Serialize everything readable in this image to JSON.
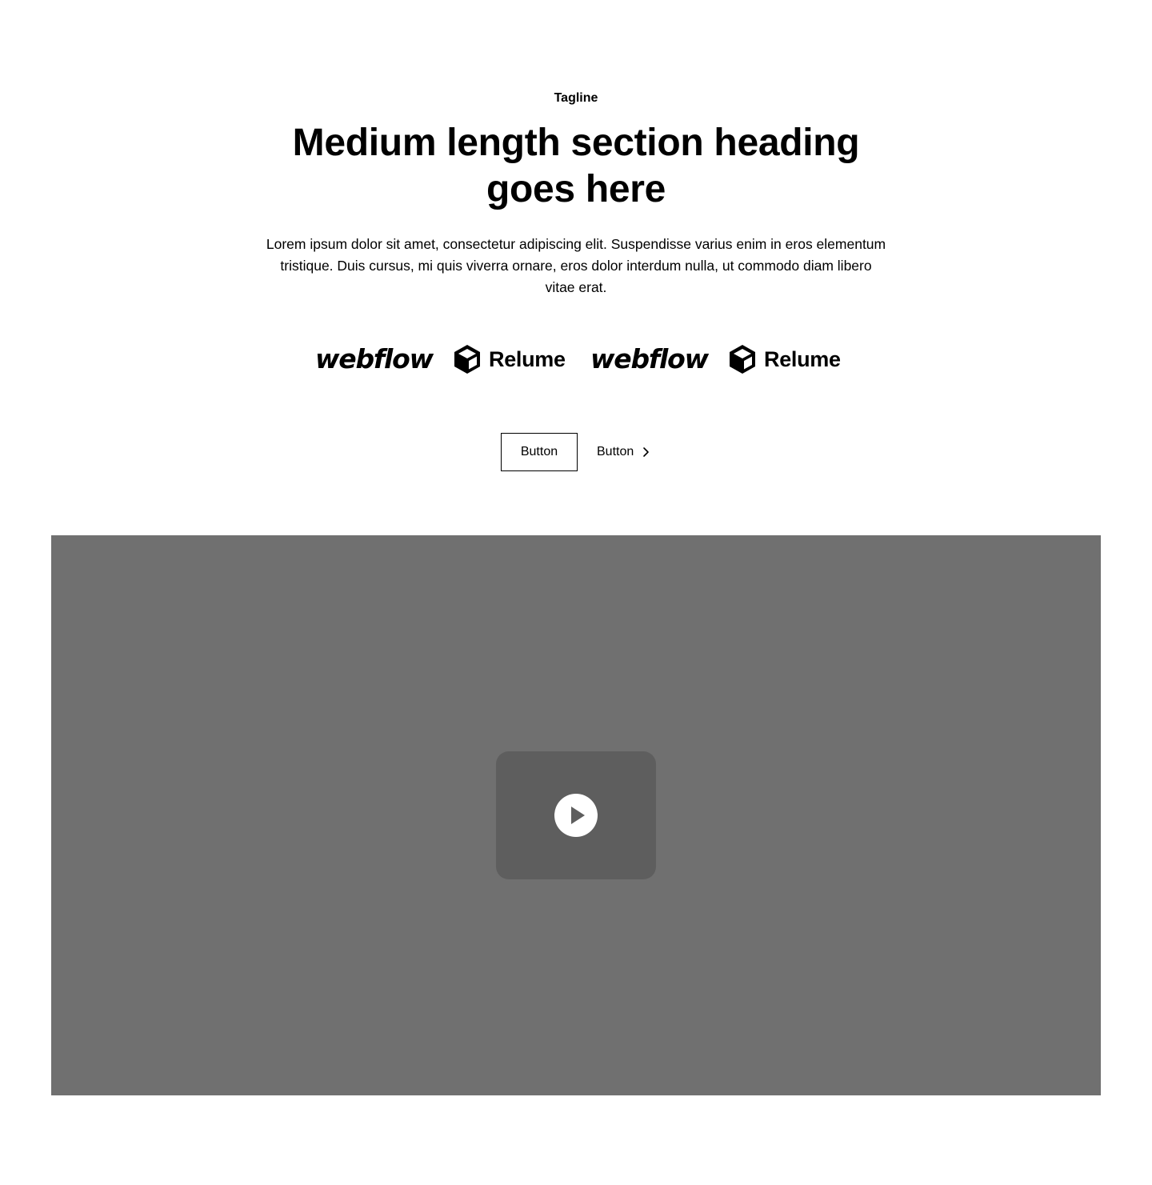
{
  "header": {
    "tagline": "Tagline",
    "heading": "Medium length section heading goes here",
    "body": "Lorem ipsum dolor sit amet, consectetur adipiscing elit. Suspendisse varius enim in eros elementum tristique. Duis cursus, mi quis viverra ornare, eros dolor interdum nulla, ut commodo diam libero vitae erat."
  },
  "logos": [
    {
      "name": "webflow",
      "icon": "webflow-logo"
    },
    {
      "name": "Relume",
      "icon": "relume-cube-logo"
    },
    {
      "name": "webflow",
      "icon": "webflow-logo"
    },
    {
      "name": "Relume",
      "icon": "relume-cube-logo"
    }
  ],
  "actions": {
    "primary_label": "Button",
    "secondary_label": "Button",
    "secondary_icon": "chevron-right-icon"
  },
  "video": {
    "play_icon": "play-icon",
    "background_color": "#707070",
    "overlay_color": "#5e5e5e"
  }
}
